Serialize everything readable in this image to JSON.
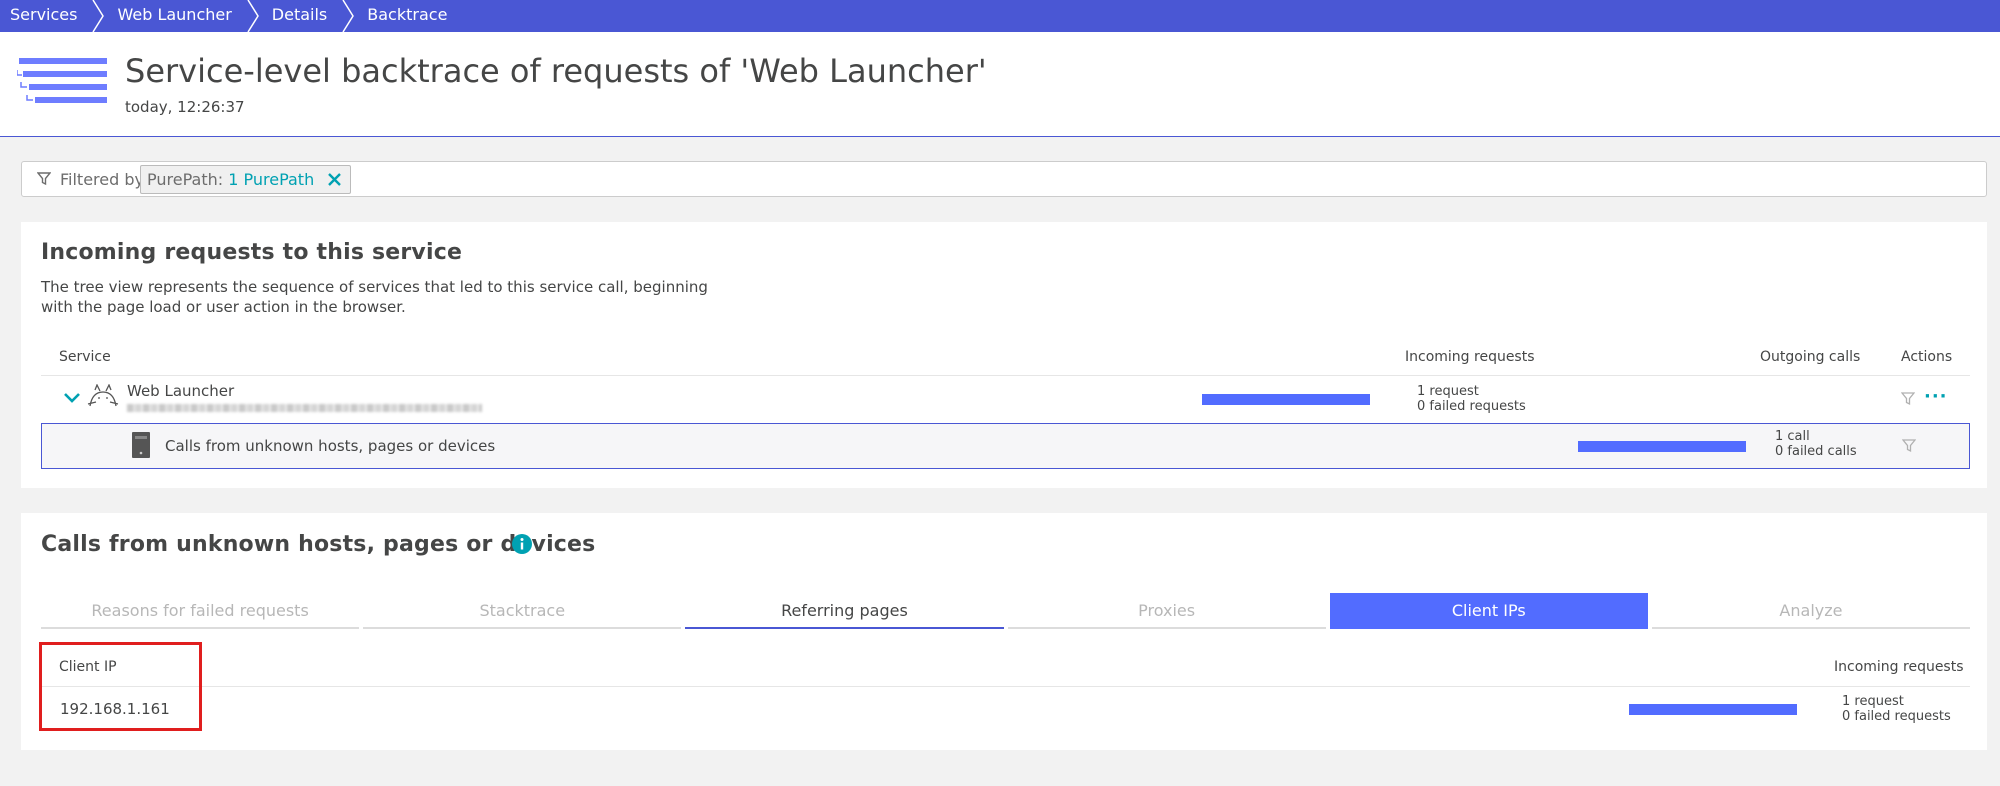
{
  "breadcrumb": [
    "Services",
    "Web Launcher",
    "Details",
    "Backtrace"
  ],
  "header": {
    "title": "Service-level backtrace of requests of 'Web Launcher'",
    "timestamp": "today, 12:26:37",
    "icon": "backtrace-tree-icon"
  },
  "filter": {
    "label": "Filtered by",
    "chip_key": "PurePath:",
    "chip_value": "1 PurePath"
  },
  "incoming": {
    "title": "Incoming requests to this service",
    "description": "The tree view represents the sequence of services that led to this service call, beginning with the page load or user action in the browser.",
    "columns": {
      "service": "Service",
      "incoming": "Incoming requests",
      "outgoing": "Outgoing calls",
      "actions": "Actions"
    },
    "rows": [
      {
        "name": "Web Launcher",
        "requests_line": "1 request",
        "failed_line": "0 failed requests",
        "icon": "tomcat-icon",
        "bar_fraction": 1
      },
      {
        "name": "Calls from unknown hosts, pages or devices",
        "calls_line": "1 call",
        "failed_line": "0 failed calls",
        "icon": "host-icon",
        "bar_fraction": 1
      }
    ]
  },
  "unknown": {
    "title": "Calls from unknown hosts, pages or devices",
    "tabs": [
      "Reasons for failed requests",
      "Stacktrace",
      "Referring pages",
      "Proxies",
      "Client IPs",
      "Analyze"
    ],
    "selected_tab": "Client IPs",
    "columns": {
      "client_ip": "Client IP",
      "incoming": "Incoming requests"
    },
    "rows": [
      {
        "ip": "192.168.1.161",
        "requests_line": "1 request",
        "failed_line": "0 failed requests",
        "bar_fraction": 1
      }
    ]
  },
  "colors": {
    "accent": "#4a57d4",
    "bar": "#526cff",
    "link": "#00a1b2",
    "highlight": "#e01e1e"
  }
}
